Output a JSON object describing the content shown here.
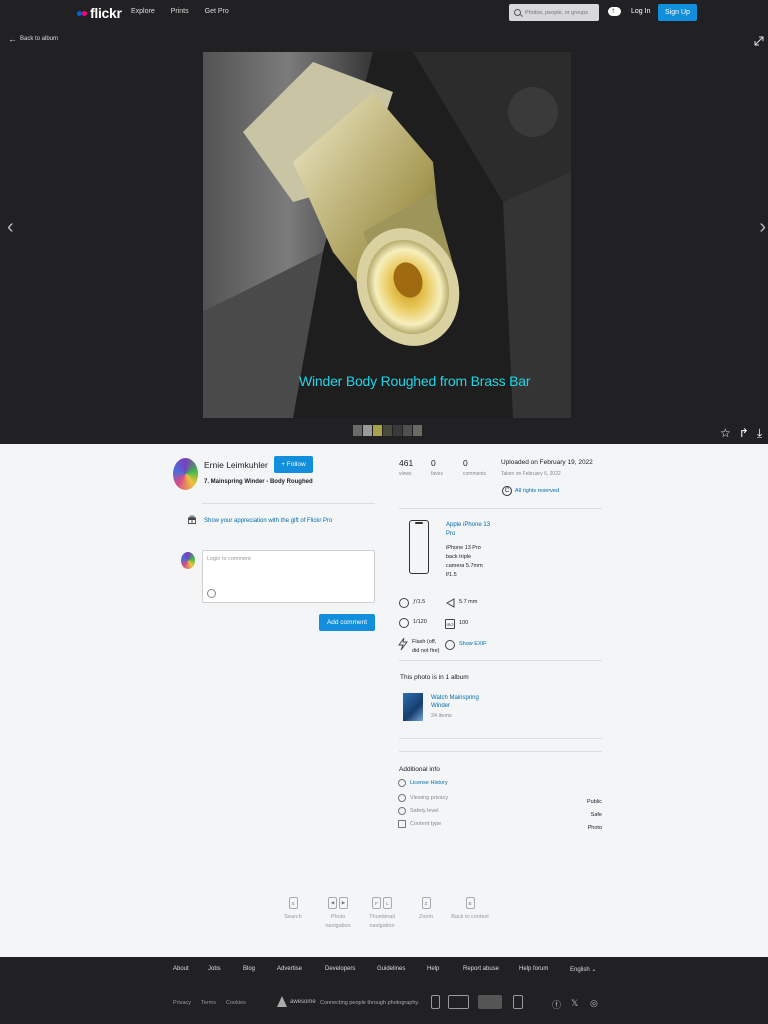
{
  "nav": {
    "logo": "flickr",
    "links": [
      "Explore",
      "Prints",
      "Get Pro"
    ],
    "search_placeholder": "Photos, people, or groups",
    "login": "Log In",
    "signup": "Sign Up"
  },
  "viewer": {
    "back_label": "Back to album",
    "caption": "Winder Body Roughed from Brass Bar",
    "filmstrip_colors": [
      "#6a6a6a",
      "#9a9a9a",
      "#a8a24a",
      "#4a4a3a",
      "#3a3a3a",
      "#505050",
      "#6a6a62"
    ]
  },
  "owner": {
    "name": "Ernie Leimkuhler",
    "follow": "Follow",
    "photo_title": "7. Mainspring Winder - Body Roughed"
  },
  "gift_text": "Show your appreciation with the gift of Flickr Pro",
  "comment": {
    "placeholder": "Login to comment",
    "button": "Add comment"
  },
  "stats": {
    "views": {
      "num": "461",
      "label": "views"
    },
    "faves": {
      "num": "0",
      "label": "faves"
    },
    "comments": {
      "num": "0",
      "label": "comments"
    },
    "uploaded": "Uploaded on February 19, 2022",
    "taken": "Taken on February 6, 2022",
    "rights": "All rights reserved"
  },
  "camera": {
    "name": "Apple iPhone 13 Pro",
    "lens": "iPhone 13 Pro back triple camera 5.7mm f/1.5"
  },
  "exif": {
    "aperture": "ƒ/1.5",
    "focal": "5.7 mm",
    "shutter": "1/120",
    "iso": "100",
    "iso_icon": "ISO",
    "flash": "Flash (off, did not fire)",
    "show_exif": "Show EXIF"
  },
  "album": {
    "heading": "This photo is in 1 album",
    "name": "Watch Mainspring Winder",
    "count": "24 items"
  },
  "additional": {
    "title": "Additional info",
    "license": "License History",
    "privacy_label": "Viewing privacy",
    "privacy_value": "Public",
    "safety_label": "Safety level",
    "safety_value": "Safe",
    "content_label": "Content type",
    "content_value": "Photo"
  },
  "shortcuts": [
    {
      "keys": [
        "S"
      ],
      "label": "Search"
    },
    {
      "keys": [
        "◀",
        "▶"
      ],
      "label": "Photo navigation"
    },
    {
      "keys": [
        "F",
        "L"
      ],
      "label": "Thumbnail navigation"
    },
    {
      "keys": [
        "Z"
      ],
      "label": "Zoom"
    },
    {
      "keys": [
        "B"
      ],
      "label": "Back to context"
    }
  ],
  "footer": {
    "links": [
      "About",
      "Jobs",
      "Blog",
      "Advertise",
      "Developers",
      "Guidelines",
      "Help",
      "Report abuse",
      "Help forum",
      "English"
    ],
    "bottom": [
      "Privacy",
      "Terms",
      "Cookies"
    ],
    "brand": "awesome",
    "tagline": "Connecting people through photography."
  }
}
